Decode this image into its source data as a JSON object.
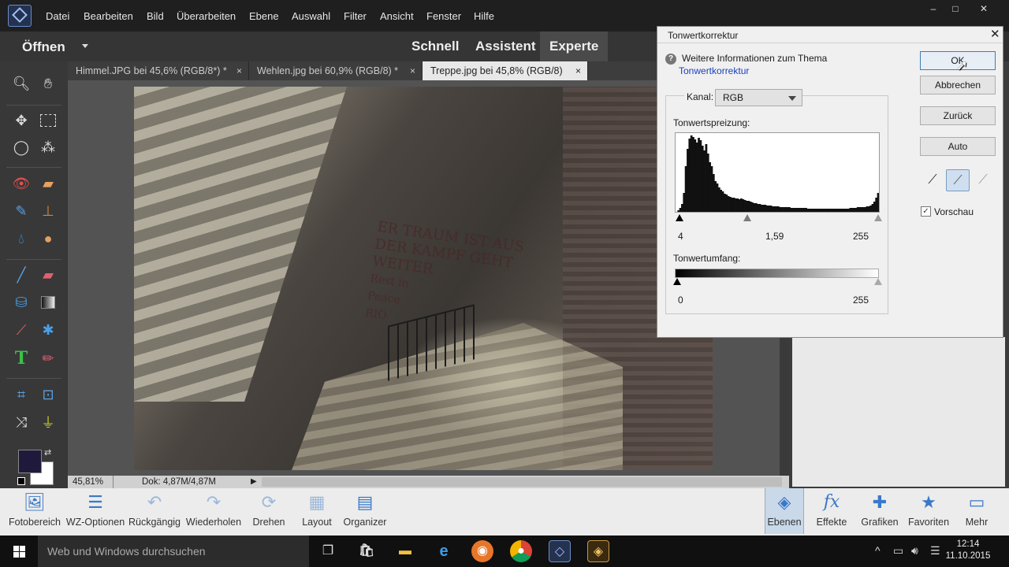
{
  "menubar": {
    "items": [
      "Datei",
      "Bearbeiten",
      "Bild",
      "Überarbeiten",
      "Ebene",
      "Auswahl",
      "Filter",
      "Ansicht",
      "Fenster",
      "Hilfe"
    ],
    "window_controls": [
      "–",
      "□",
      "✕"
    ]
  },
  "modebar": {
    "open_label": "Öffnen",
    "modes": [
      "Schnell",
      "Assistent",
      "Experte"
    ],
    "active_mode": "Experte"
  },
  "tabs": [
    {
      "label": "Himmel.JPG bei 45,6% (RGB/8*) *",
      "close": "×",
      "active": false
    },
    {
      "label": "Wehlen.jpg bei 60,9% (RGB/8) *",
      "close": "×",
      "active": false
    },
    {
      "label": "Treppe.jpg bei 45,8% (RGB/8)",
      "close": "×",
      "active": true
    }
  ],
  "canvas": {
    "graffiti_lines": [
      "ER TRAUM IST AUS",
      "DER KAMPF GEHT",
      "WEITER",
      "Rest in",
      "Peace",
      "RIO"
    ]
  },
  "statusbar": {
    "zoom": "45,81%",
    "doc_size": "Dok: 4,87M/4,87M"
  },
  "toolbox": {
    "tools": [
      "zoom-icon",
      "hand-icon",
      "move-icon",
      "marquee-icon",
      "lasso-icon",
      "quick-selection-icon",
      "red-eye-icon",
      "healing-brush-icon",
      "smart-brush-icon",
      "clone-stamp-icon",
      "blur-icon",
      "sponge-icon",
      "brush-icon",
      "eraser-icon",
      "paint-bucket-icon",
      "gradient-icon",
      "eyedropper-icon",
      "custom-shape-icon",
      "type-icon",
      "pencil-icon",
      "crop-icon",
      "recompose-icon",
      "content-aware-move-icon",
      "straighten-icon"
    ],
    "foreground_color": "#1f1a3c",
    "background_color": "#ffffff"
  },
  "appbar": {
    "left_buttons": [
      {
        "name": "fotobereich",
        "label": "Fotobereich",
        "icon": "🖼"
      },
      {
        "name": "wz-optionen",
        "label": "WZ-Optionen",
        "icon": "☰"
      },
      {
        "name": "rueckgaengig",
        "label": "Rückgängig",
        "icon": "↶"
      },
      {
        "name": "wiederholen",
        "label": "Wiederholen",
        "icon": "↷"
      },
      {
        "name": "drehen",
        "label": "Drehen",
        "icon": "⟳"
      },
      {
        "name": "layout",
        "label": "Layout",
        "icon": "▦"
      },
      {
        "name": "organizer",
        "label": "Organizer",
        "icon": "▤"
      }
    ],
    "right_buttons": [
      {
        "name": "ebenen",
        "label": "Ebenen",
        "icon": "◈"
      },
      {
        "name": "effekte",
        "label": "Effekte",
        "icon": "fx"
      },
      {
        "name": "grafiken",
        "label": "Grafiken",
        "icon": "✚"
      },
      {
        "name": "favoriten",
        "label": "Favoriten",
        "icon": "★"
      },
      {
        "name": "mehr",
        "label": "Mehr",
        "icon": "▭"
      }
    ]
  },
  "taskbar": {
    "search_placeholder": "Web und Windows durchsuchen",
    "time": "12:14",
    "date": "11.10.2015",
    "pinned": [
      "task-view-icon",
      "store-icon",
      "file-explorer-icon",
      "edge-icon",
      "firefox-icon",
      "chrome-icon",
      "photoshop-elements-icon",
      "elements-organizer-icon"
    ],
    "tray_icons": [
      "^",
      "network-icon",
      "speaker-icon",
      "notifications-icon"
    ]
  },
  "dialog": {
    "title": "Tonwertkorrektur",
    "close": "✕",
    "help_text": "Weitere Informationen zum Thema",
    "help_link": "Tonwertkorrektur",
    "channel_label": "Kanal:",
    "channel_value": "RGB",
    "input_label": "Tonwertspreizung:",
    "input_black": "4",
    "input_gamma": "1,59",
    "input_white": "255",
    "output_label": "Tonwertumfang:",
    "output_black": "0",
    "output_white": "255",
    "buttons": {
      "ok": "OK",
      "cancel": "Abbrechen",
      "reset": "Zurück",
      "auto": "Auto"
    },
    "preview_label": "Vorschau",
    "preview_checked": true,
    "histogram": [
      0,
      2,
      5,
      10,
      24,
      58,
      80,
      93,
      97,
      95,
      92,
      88,
      94,
      91,
      84,
      78,
      86,
      74,
      63,
      58,
      48,
      39,
      36,
      31,
      28,
      26,
      23,
      22,
      20,
      19,
      18,
      18,
      17,
      17,
      16,
      17,
      16,
      15,
      14,
      14,
      13,
      12,
      11,
      11,
      10,
      10,
      9,
      9,
      9,
      8,
      8,
      8,
      7,
      7,
      7,
      7,
      6,
      6,
      6,
      6,
      6,
      6,
      5,
      5,
      5,
      5,
      5,
      5,
      5,
      5,
      5,
      4,
      4,
      4,
      4,
      4,
      4,
      4,
      4,
      4,
      4,
      4,
      4,
      4,
      4,
      4,
      4,
      4,
      4,
      4,
      4,
      4,
      4,
      4,
      5,
      5,
      5,
      5,
      6,
      6,
      6,
      6,
      6,
      7,
      7,
      8,
      10,
      13,
      18,
      24
    ]
  }
}
